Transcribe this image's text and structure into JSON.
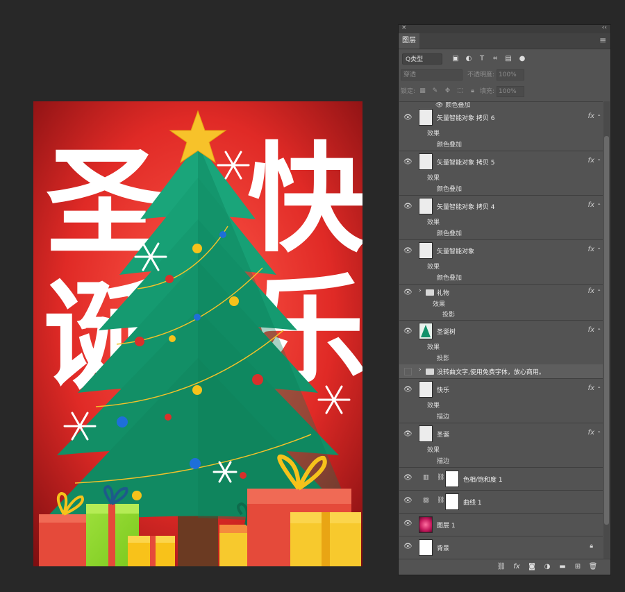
{
  "canvas": {
    "title_left_top": "圣",
    "title_left_bottom": "诞",
    "title_right_top": "快",
    "title_right_bottom": "乐",
    "colors": {
      "background": "#e32526",
      "tree": "#12916a",
      "star": "#f7c22a"
    }
  },
  "panel": {
    "close": "×",
    "collapse": "‹‹",
    "tab": "图层",
    "menu": "≡",
    "filter_kind": "Q类型",
    "blend_mode": "穿透",
    "opacity_label": "不透明度:",
    "opacity_value": "100%",
    "lock_label": "锁定:",
    "fill_label": "填充:",
    "fill_value": "100%",
    "partial_effect": "颜色叠加",
    "layers": [
      {
        "name": "矢量智能对象 拷贝 6",
        "fx": "fx",
        "effects_label": "效果",
        "effect": "颜色叠加"
      },
      {
        "name": "矢量智能对象 拷贝 5",
        "fx": "fx",
        "effects_label": "效果",
        "effect": "颜色叠加"
      },
      {
        "name": "矢量智能对象 拷贝 4",
        "fx": "fx",
        "effects_label": "效果",
        "effect": "颜色叠加"
      },
      {
        "name": "矢量智能对象",
        "fx": "fx",
        "effects_label": "效果",
        "effect": "颜色叠加"
      },
      {
        "name": "礼物",
        "fx": "fx",
        "effects_label": "效果",
        "effect": "投影"
      },
      {
        "name": "圣诞树",
        "fx": "fx",
        "effects_label": "效果",
        "effect": "投影"
      },
      {
        "name": "没转曲文字,使用免费字体，放心商用。"
      },
      {
        "name": "快乐",
        "fx": "fx",
        "effects_label": "效果",
        "effect": "描边"
      },
      {
        "name": "圣诞",
        "fx": "fx",
        "effects_label": "效果",
        "effect": "描边"
      },
      {
        "name": "色相/饱和度 1"
      },
      {
        "name": "曲线 1"
      },
      {
        "name": "图层 1"
      },
      {
        "name": "背景"
      }
    ]
  }
}
